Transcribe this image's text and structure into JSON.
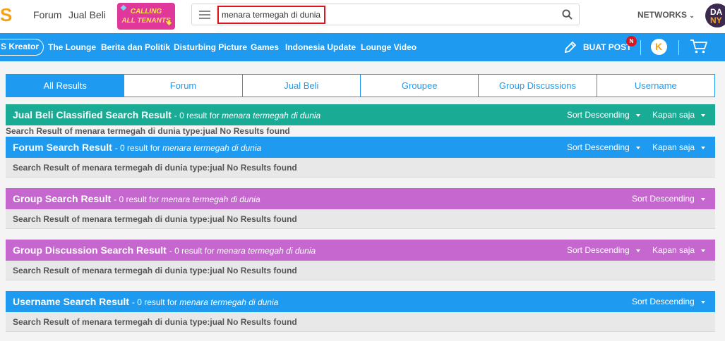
{
  "header": {
    "logo_text": "S",
    "nav_forum": "Forum",
    "nav_jualbeli": "Jual Beli",
    "promo_line1": "CALLING",
    "promo_line2": "ALL TENANTS",
    "search_value": "menara termegah di dunia",
    "networks_label": "NETWORKS",
    "avatar_line1": "DA",
    "avatar_line2": "NY"
  },
  "bluenav": {
    "kreator_label": "S Kreator",
    "links": [
      "The Lounge",
      "Berita dan Politik",
      "Disturbing Picture",
      "Games",
      "Indonesia Update",
      "Lounge Video"
    ],
    "buat_post_label": "BUAT POST",
    "notif_badge": "N",
    "k_icon_letter": "K"
  },
  "tabs": [
    "All Results",
    "Forum",
    "Jual Beli",
    "Groupee",
    "Group Discussions",
    "Username"
  ],
  "sections": {
    "jualbeli": {
      "title": "Jual Beli Classified Search Result",
      "meta": "- 0 result for",
      "query": "menara termegah di dunia",
      "sort": "Sort Descending",
      "time": "Kapan saja",
      "message": "Search Result of menara termegah di dunia type:jual No Results found"
    },
    "forum": {
      "title": "Forum Search Result",
      "meta": "- 0 result for",
      "query": "menara termegah di dunia",
      "sort": "Sort Descending",
      "time": "Kapan saja",
      "message": "Search Result of menara termegah di dunia type:jual No Results found"
    },
    "group": {
      "title": "Group Search Result",
      "meta": "- 0 result for",
      "query": "menara termegah di dunia",
      "sort": "Sort Descending",
      "message": "Search Result of menara termegah di dunia type:jual No Results found"
    },
    "groupdiscussion": {
      "title": "Group Discussion Search Result",
      "meta": "- 0 result for",
      "query": "menara termegah di dunia",
      "sort": "Sort Descending",
      "time": "Kapan saja",
      "message": "Search Result of menara termegah di dunia type:jual No Results found"
    },
    "username": {
      "title": "Username Search Result",
      "meta": "- 0 result for",
      "query": "menara termegah di dunia",
      "sort": "Sort Descending",
      "message": "Search Result of menara termegah di dunia type:jual No Results found"
    }
  },
  "colors": {
    "accent_blue": "#1e9bf0",
    "teal": "#1aab95",
    "purple": "#c567cf",
    "brand_orange": "#f7a11a"
  }
}
